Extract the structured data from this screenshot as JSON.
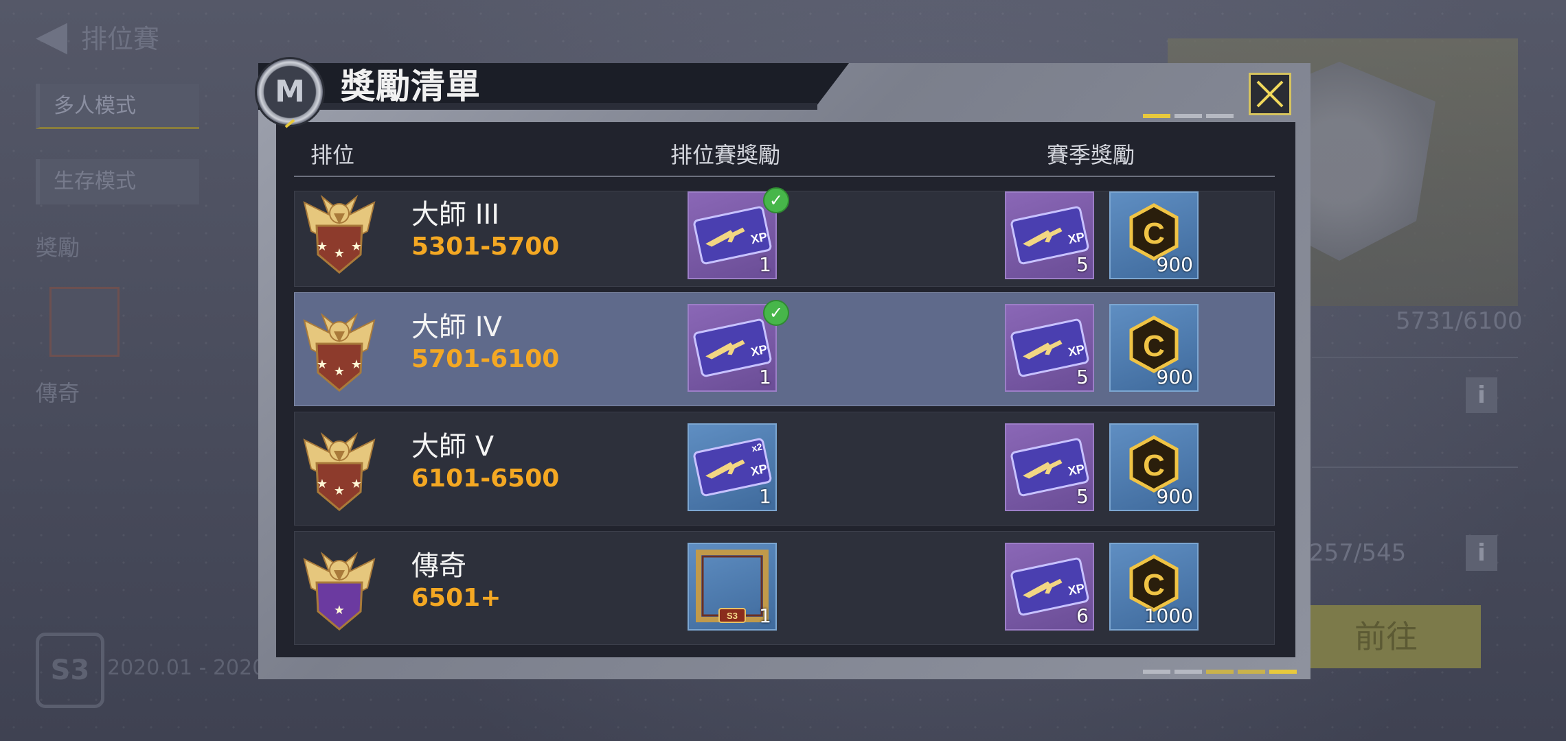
{
  "background": {
    "back_arrow": "◀",
    "title": "排位賽",
    "tabs": [
      "多人模式",
      "生存模式"
    ],
    "section_label": "獎勵",
    "tier_label": "傳奇",
    "season_badge": "S3",
    "season_dates": "2020.01 - 2020.",
    "progress_1": "5731/6100",
    "progress_2": "257/545",
    "go_button": "前往",
    "info_icon": "i"
  },
  "modal": {
    "title": "獎勵清單",
    "logo_glyph": "M",
    "columns": {
      "rank": "排位",
      "ranked_reward": "排位賽獎勵",
      "season_reward": "賽季獎勵"
    },
    "rows": [
      {
        "name": "大師 III",
        "range": "5301-5700",
        "selected": false,
        "ranked_reward": {
          "type": "xp-card",
          "color": "purple",
          "count": "1",
          "claimed": true
        },
        "season_rewards": [
          {
            "type": "xp-card",
            "color": "purple",
            "count": "5"
          },
          {
            "type": "cod-points",
            "color": "blue",
            "count": "900"
          }
        ]
      },
      {
        "name": "大師 IV",
        "range": "5701-6100",
        "selected": true,
        "ranked_reward": {
          "type": "xp-card",
          "color": "purple",
          "count": "1",
          "claimed": true
        },
        "season_rewards": [
          {
            "type": "xp-card",
            "color": "purple",
            "count": "5"
          },
          {
            "type": "cod-points",
            "color": "blue",
            "count": "900"
          }
        ]
      },
      {
        "name": "大師 V",
        "range": "6101-6500",
        "selected": false,
        "ranked_reward": {
          "type": "xp-card-x2",
          "color": "blue",
          "count": "1",
          "claimed": false
        },
        "season_rewards": [
          {
            "type": "xp-card",
            "color": "purple",
            "count": "5"
          },
          {
            "type": "cod-points",
            "color": "blue",
            "count": "900"
          }
        ]
      },
      {
        "name": "傳奇",
        "range": "6501+",
        "selected": false,
        "ranked_reward": {
          "type": "frame",
          "color": "blue",
          "count": "1",
          "claimed": false,
          "label": "S3"
        },
        "season_rewards": [
          {
            "type": "xp-card",
            "color": "purple",
            "count": "6"
          },
          {
            "type": "cod-points",
            "color": "blue",
            "count": "1000"
          }
        ]
      }
    ],
    "xp_text": "XP",
    "x2_text": "x2",
    "cp_letter": "C"
  },
  "colors": {
    "accent_gold": "#e8c93c",
    "range_orange": "#f4a823",
    "selected_row": "#5f6a8b",
    "check_green": "#47b64a"
  }
}
